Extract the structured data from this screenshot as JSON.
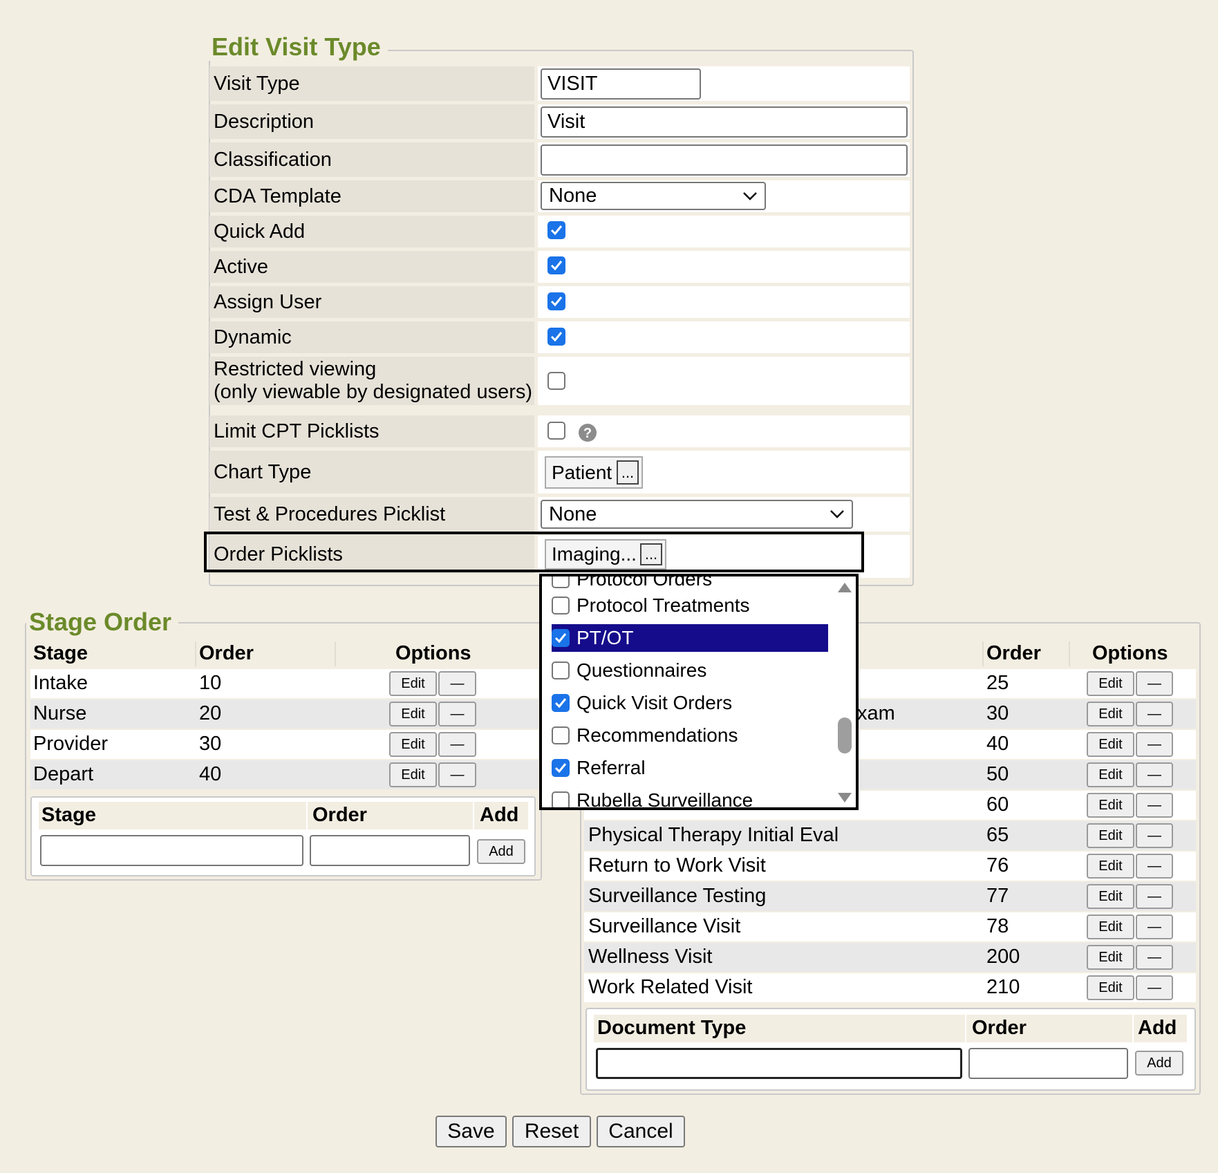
{
  "edit_visit_type": {
    "legend": "Edit Visit Type",
    "visit_type_label": "Visit Type",
    "visit_type_value": "VISIT",
    "description_label": "Description",
    "description_value": "Visit",
    "classification_label": "Classification",
    "classification_value": "",
    "cda_template_label": "CDA Template",
    "cda_template_value": "None",
    "quick_add_label": "Quick Add",
    "active_label": "Active",
    "assign_user_label": "Assign User",
    "dynamic_label": "Dynamic",
    "restricted_label_line1": "Restricted viewing",
    "restricted_label_line2": "(only viewable by designated users)",
    "limit_cpt_label": "Limit CPT Picklists",
    "chart_type_label": "Chart Type",
    "chart_type_value": "Patient",
    "chart_type_more": "...",
    "test_procedures_label": "Test & Procedures Picklist",
    "test_procedures_value": "None",
    "order_picklists_label": "Order Picklists",
    "order_picklists_value": "Imaging...",
    "order_picklists_more": "...",
    "checkboxes": {
      "quick_add": true,
      "active": true,
      "assign_user": true,
      "dynamic": true,
      "restricted": false,
      "limit_cpt": false
    }
  },
  "dropdown": {
    "clipped_top": "Protocol Orders",
    "items": [
      {
        "label": "Protocol Treatments",
        "checked": false
      },
      {
        "label": "PT/OT",
        "checked": true
      },
      {
        "label": "Questionnaires",
        "checked": false
      },
      {
        "label": "Quick Visit Orders",
        "checked": true
      },
      {
        "label": "Recommendations",
        "checked": false
      },
      {
        "label": "Referral",
        "checked": true
      },
      {
        "label": "Rubella Surveillance",
        "checked": false
      }
    ]
  },
  "stage_order": {
    "legend": "Stage Order",
    "headers": {
      "stage": "Stage",
      "order": "Order",
      "options": "Options"
    },
    "rows": [
      {
        "stage": "Intake",
        "order": "10"
      },
      {
        "stage": "Nurse",
        "order": "20"
      },
      {
        "stage": "Provider",
        "order": "30"
      },
      {
        "stage": "Depart",
        "order": "40"
      }
    ],
    "edit_label": "Edit",
    "remove_label": "—",
    "add_headers": {
      "stage": "Stage",
      "order": "Order",
      "add": "Add"
    },
    "add_button": "Add"
  },
  "document_order": {
    "headers": {
      "order": "Order",
      "options": "Options"
    },
    "rows": [
      {
        "name": "",
        "order": "25"
      },
      {
        "name": "xam",
        "order": "30"
      },
      {
        "name": "",
        "order": "40"
      },
      {
        "name": "",
        "order": "50"
      },
      {
        "name": "",
        "order": "60"
      },
      {
        "name": "Physical Therapy Initial Eval",
        "order": "65"
      },
      {
        "name": "Return to Work Visit",
        "order": "76"
      },
      {
        "name": "Surveillance Testing",
        "order": "77"
      },
      {
        "name": "Surveillance Visit",
        "order": "78"
      },
      {
        "name": "Wellness Visit",
        "order": "200"
      },
      {
        "name": "Work Related Visit",
        "order": "210"
      }
    ],
    "edit_label": "Edit",
    "remove_label": "—",
    "add_headers": {
      "document_type": "Document Type",
      "order": "Order",
      "add": "Add"
    },
    "add_button": "Add"
  },
  "footer": {
    "save": "Save",
    "reset": "Reset",
    "cancel": "Cancel"
  }
}
